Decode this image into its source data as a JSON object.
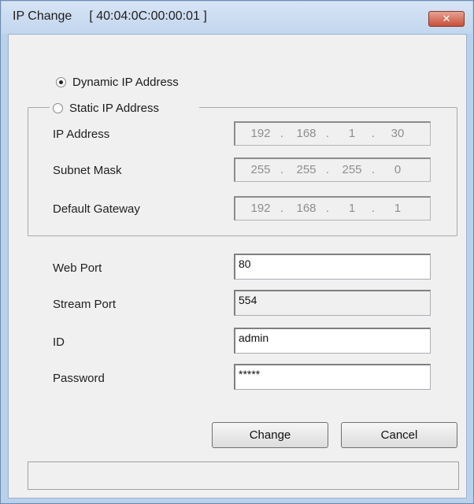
{
  "window": {
    "title": "IP Change",
    "mac": "[ 40:04:0C:00:00:01 ]",
    "close_glyph": "✕"
  },
  "mode": {
    "dynamic_label": "Dynamic IP Address",
    "static_label": "Static IP Address",
    "selected": "dynamic"
  },
  "static": {
    "ip_label": "IP Address",
    "ip": [
      "192",
      "168",
      "1",
      "30"
    ],
    "subnet_label": "Subnet Mask",
    "subnet": [
      "255",
      "255",
      "255",
      "0"
    ],
    "gateway_label": "Default Gateway",
    "gateway": [
      "192",
      "168",
      "1",
      "1"
    ],
    "separator": "."
  },
  "fields": {
    "web_port_label": "Web Port",
    "web_port": "80",
    "stream_port_label": "Stream Port",
    "stream_port": "554",
    "id_label": "ID",
    "id": "admin",
    "password_label": "Password",
    "password": "*****"
  },
  "buttons": {
    "change": "Change",
    "cancel": "Cancel"
  },
  "status_text": ""
}
